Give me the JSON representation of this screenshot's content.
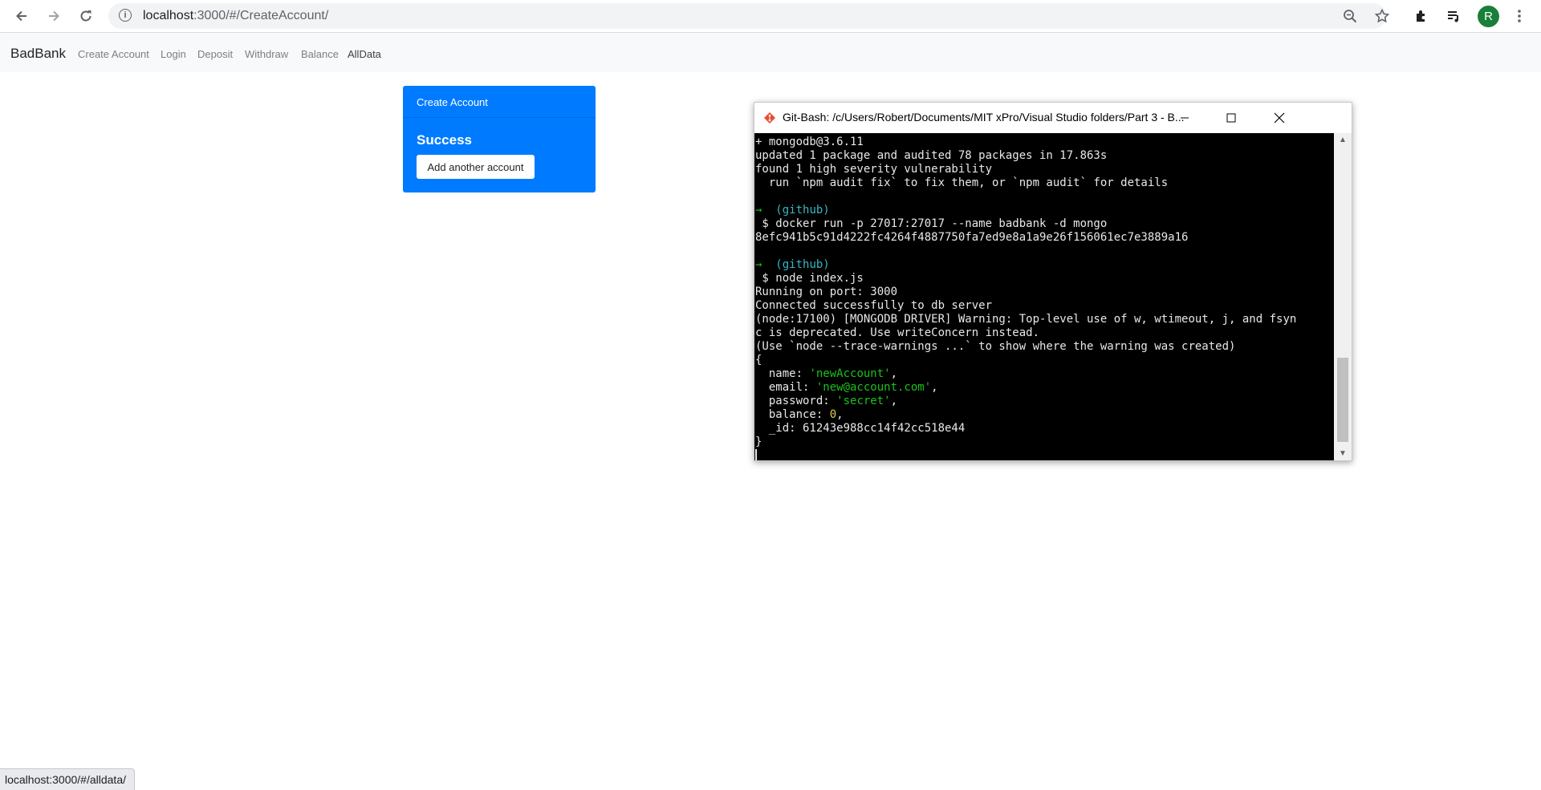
{
  "browser": {
    "url_host": "localhost",
    "url_rest": ":3000/#/CreateAccount/",
    "profile_initial": "R"
  },
  "navbar": {
    "brand": "BadBank",
    "links": [
      "Create Account",
      "Login",
      "Deposit",
      "Withdraw",
      "Balance",
      "AllData"
    ]
  },
  "card": {
    "header": "Create Account",
    "title": "Success",
    "button_label": "Add another account"
  },
  "terminal": {
    "title": "Git-Bash: /c/Users/Robert/Documents/MIT xPro/Visual Studio folders/Part 3 - B...",
    "lines": [
      "+ mongodb@3.6.11",
      "updated 1 package and audited 78 packages in 17.863s",
      "found 1 high severity vulnerability",
      "  run `npm audit fix` to fix them, or `npm audit` for details",
      "",
      "→  (github)",
      " $ docker run -p 27017:27017 --name badbank -d mongo",
      "8efc941b5c91d4222fc4264f4887750fa7ed9e8a1a9e26f156061ec7e3889a16",
      "",
      "→  (github)",
      " $ node index.js",
      "Running on port: 3000",
      "Connected successfully to db server",
      "(node:17100) [MONGODB DRIVER] Warning: Top-level use of w, wtimeout, j, and fsyn",
      "c is deprecated. Use writeConcern instead.",
      "(Use `node --trace-warnings ...` to show where the warning was created)",
      "{",
      "  name: 'newAccount',",
      "  email: 'new@account.com',",
      "  password: 'secret',",
      "  balance: 0,",
      "  _id: 61243e988cc14f42cc518e44",
      "}"
    ]
  },
  "status_url": "localhost:3000/#/alldata/",
  "colors": {
    "card_bg": "#007bff",
    "navbar_bg": "#f8f9fa",
    "terminal_bg": "#000000",
    "term_cyan": "#38b6c4",
    "term_green": "#1bc21b"
  }
}
